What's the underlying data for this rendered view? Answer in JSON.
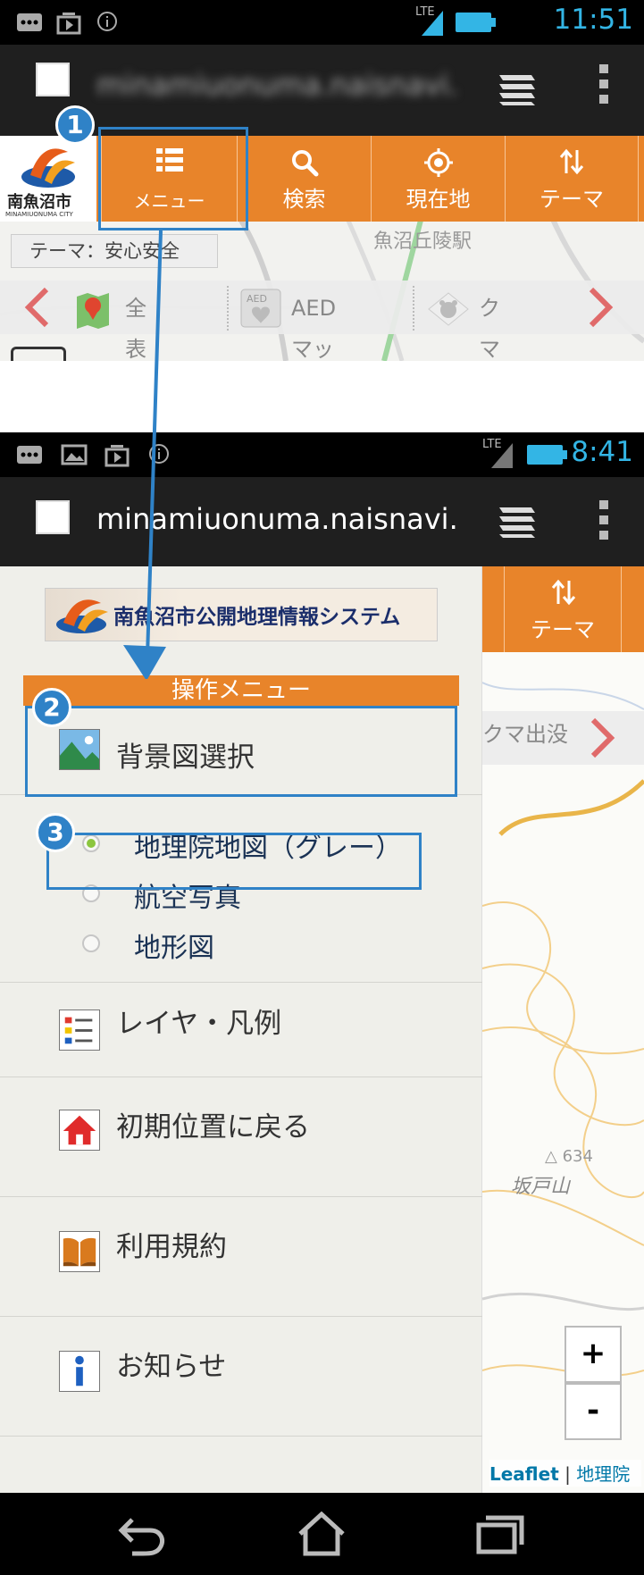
{
  "screen1": {
    "status": {
      "time": "11:51",
      "net": "LTE"
    },
    "browser": {
      "url": "minamiuonuma.naisnavi."
    },
    "logo": {
      "title": "南魚沼市",
      "subtitle": "MINAMIUONUMA CITY"
    },
    "toolbar": [
      {
        "label": "メニュー",
        "icon": "list-icon"
      },
      {
        "label": "検索",
        "icon": "search-icon"
      },
      {
        "label": "現在地",
        "icon": "location-icon"
      },
      {
        "label": "テーマ",
        "icon": "swap-icon"
      }
    ],
    "theme_label": "テーマ：安心安全",
    "map_label": "魚沼丘陵駅",
    "theme_items": [
      {
        "label": "全表示",
        "icon": "map-pin-icon"
      },
      {
        "label": "AEDマップ",
        "icon": "aed-icon"
      },
      {
        "label": "クマ出没",
        "icon": "bear-icon"
      }
    ],
    "badge": "1"
  },
  "screen2": {
    "status": {
      "time": "8:41",
      "net": "LTE"
    },
    "browser": {
      "url": "minamiuonuma.naisnavi."
    },
    "toolbar_theme": "テーマ",
    "map_visible_theme": "クマ出没",
    "banner": "南魚沼市公開地理情報システム",
    "menu_header": "操作メニュー",
    "background_select": "背景図選択",
    "radios": [
      {
        "label": "地理院地図（グレー）",
        "selected": true
      },
      {
        "label": "航空写真",
        "selected": false
      },
      {
        "label": "地形図",
        "selected": false
      }
    ],
    "menu_items": [
      {
        "label": "レイヤ・凡例",
        "icon": "layer-legend-icon"
      },
      {
        "label": "初期位置に戻る",
        "icon": "home-icon"
      },
      {
        "label": "利用規約",
        "icon": "book-icon"
      },
      {
        "label": "お知らせ",
        "icon": "info-icon"
      }
    ],
    "map_peak": "△ 634",
    "map_place": "坂戸山",
    "zoom_in": "+",
    "zoom_out": "-",
    "attribution": {
      "leaflet": "Leaflet",
      "sep": " | ",
      "gsi": "地理院"
    },
    "badges": [
      "2",
      "3"
    ]
  },
  "colors": {
    "accent": "#e8842a",
    "callout": "#2f82c7",
    "status_time": "#33b5e5"
  }
}
